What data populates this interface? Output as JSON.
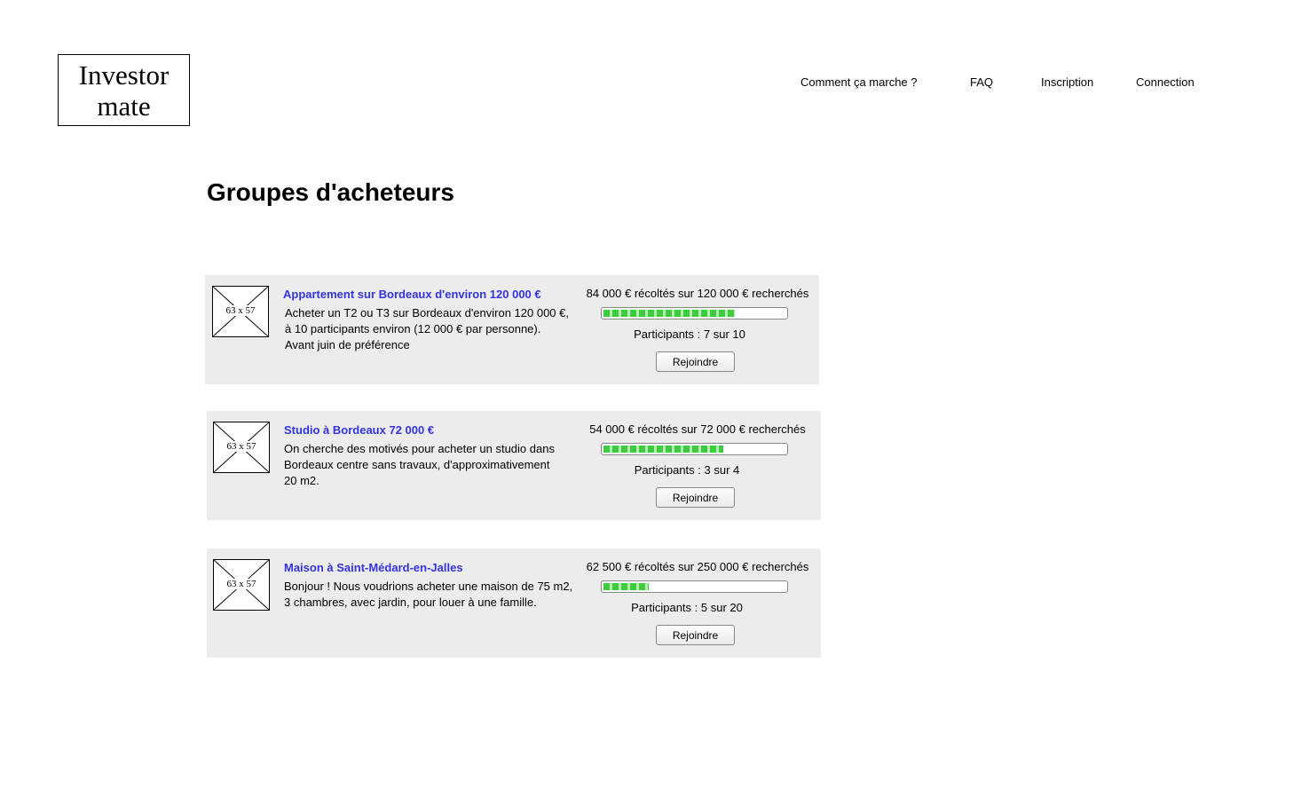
{
  "logo": {
    "line1": "Investor",
    "line2": "mate"
  },
  "nav": {
    "how": "Comment ça marche ?",
    "faq": "FAQ",
    "signup": "Inscription",
    "login": "Connection"
  },
  "page_title": "Groupes d'acheteurs",
  "groups": [
    {
      "image_placeholder": "63 x 57",
      "title": "Appartement sur Bordeaux d'environ 120 000 €",
      "description_lines": [
        "Acheter un T2 ou T3 sur Bordeaux d'environ 120 000 €,",
        "à 10 participants environ (12 000 € par personne).",
        "Avant juin de préférence"
      ],
      "funds": "84 000 € récoltés sur 120 000 € recherchés",
      "progress": 0.72,
      "participants": "Participants : 7 sur 10",
      "join_label": "Rejoindre"
    },
    {
      "image_placeholder": "63 x 57",
      "title": "Studio à Bordeaux 72 000 €",
      "description_lines": [
        "On cherche des motivés pour acheter un studio dans",
        "Bordeaux centre sans travaux, d'approximativement",
        "20 m2."
      ],
      "funds": "54 000 € récoltés sur 72 000 € recherchés",
      "progress": 0.66,
      "participants": "Participants : 3 sur 4",
      "join_label": "Rejoindre"
    },
    {
      "image_placeholder": "63 x 57",
      "title": "Maison à Saint-Médard-en-Jalles",
      "description_lines": [
        "Bonjour ! Nous voudrions acheter une maison de 75 m2,",
        "3 chambres, avec jardin, pour louer à une famille."
      ],
      "funds": "62 500 € récoltés sur 250 000 € recherchés",
      "progress": 0.25,
      "participants": "Participants : 5 sur 20",
      "join_label": "Rejoindre"
    }
  ]
}
